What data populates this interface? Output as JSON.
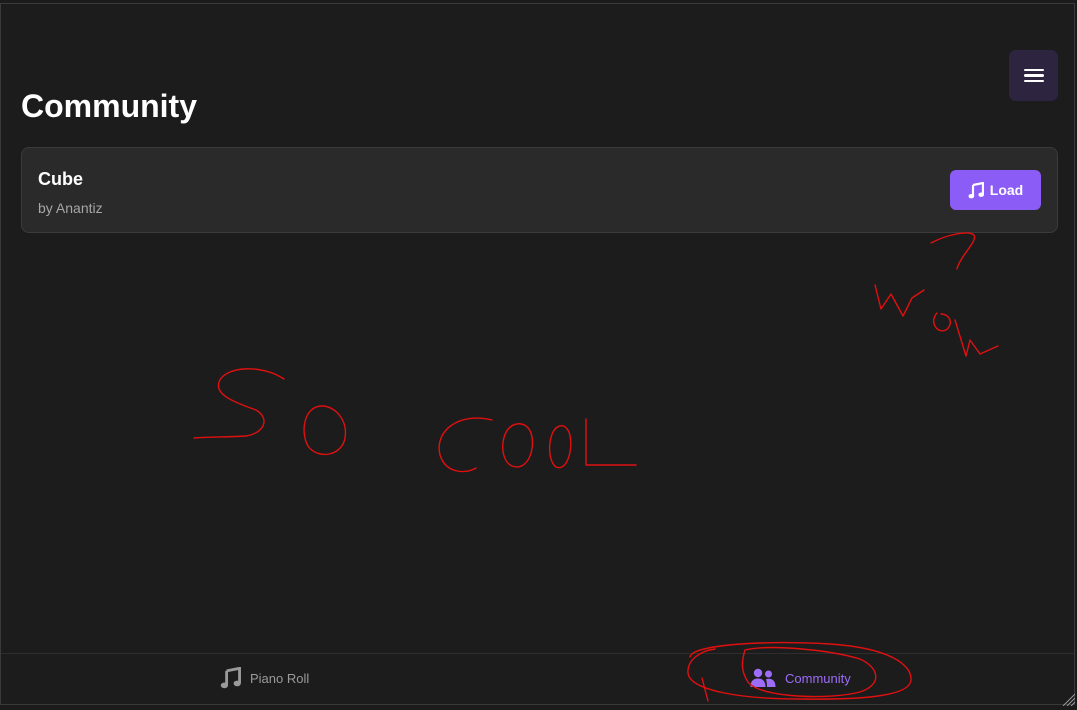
{
  "header": {
    "menu_icon": "hamburger-menu-icon"
  },
  "page": {
    "title": "Community"
  },
  "songs": [
    {
      "title": "Cube",
      "author": "by Anantiz",
      "load_label": "Load",
      "load_icon": "music-note-icon"
    }
  ],
  "bottom_nav": {
    "items": [
      {
        "label": "Piano Roll",
        "icon": "music-note-icon",
        "active": false
      },
      {
        "label": "Community",
        "icon": "users-icon",
        "active": true
      }
    ]
  },
  "annotations": {
    "texts": [
      "So Cool",
      "Wow"
    ]
  },
  "colors": {
    "background": "#1c1c1c",
    "card": "#2a2a2a",
    "accent": "#8b5cf6",
    "menu_button": "#2d2440",
    "annotation_ink": "#e01010",
    "muted_text": "#9a9a9a"
  }
}
